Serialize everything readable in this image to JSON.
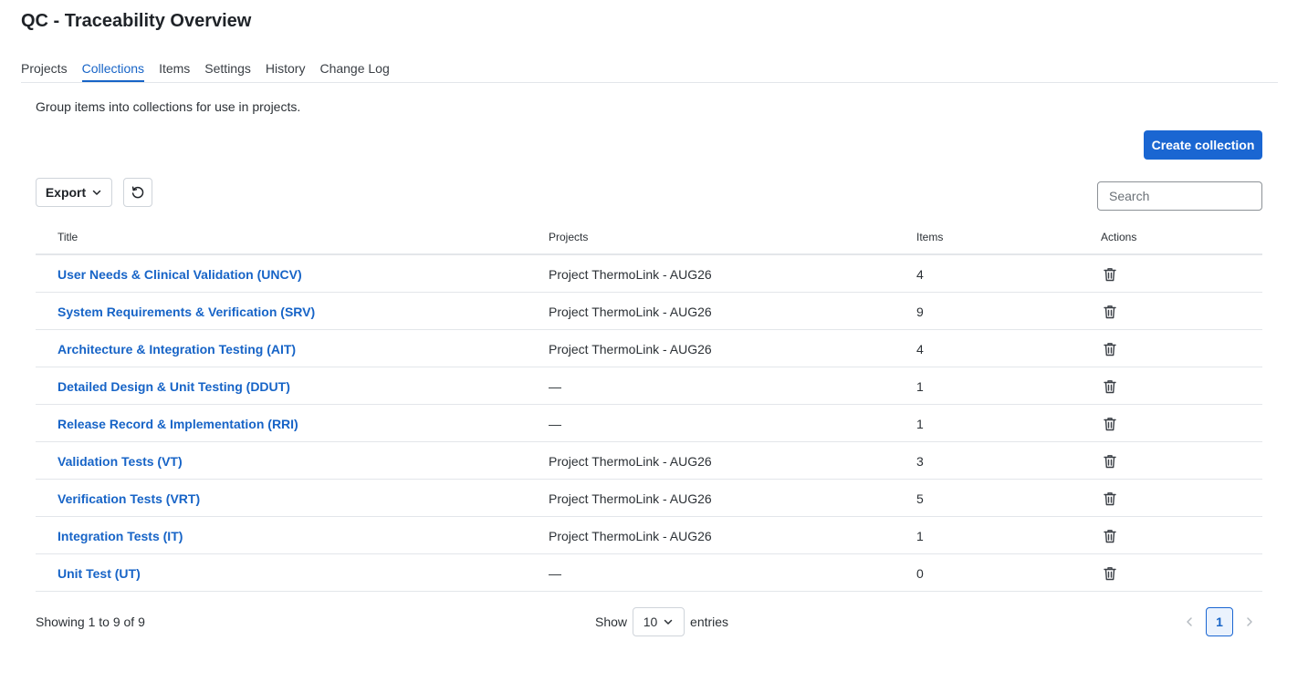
{
  "page": {
    "title": "QC - Traceability Overview"
  },
  "tabs": [
    {
      "label": "Projects"
    },
    {
      "label": "Collections",
      "active": true
    },
    {
      "label": "Items"
    },
    {
      "label": "Settings"
    },
    {
      "label": "History"
    },
    {
      "label": "Change Log"
    }
  ],
  "description": "Group items into collections for use in projects.",
  "toolbar": {
    "create_label": "Create collection",
    "export_label": "Export",
    "search_placeholder": "Search"
  },
  "table": {
    "headers": {
      "title": "Title",
      "projects": "Projects",
      "items": "Items",
      "actions": "Actions"
    },
    "rows": [
      {
        "title": "User Needs & Clinical Validation (UNCV)",
        "project": "Project ThermoLink - AUG26",
        "items": "4"
      },
      {
        "title": "System Requirements & Verification (SRV)",
        "project": "Project ThermoLink - AUG26",
        "items": "9"
      },
      {
        "title": "Architecture & Integration Testing (AIT)",
        "project": "Project ThermoLink - AUG26",
        "items": "4"
      },
      {
        "title": "Detailed Design & Unit Testing (DDUT)",
        "project": "—",
        "items": "1"
      },
      {
        "title": "Release Record & Implementation (RRI)",
        "project": "—",
        "items": "1"
      },
      {
        "title": "Validation Tests (VT)",
        "project": "Project ThermoLink - AUG26",
        "items": "3"
      },
      {
        "title": "Verification Tests (VRT)",
        "project": "Project ThermoLink - AUG26",
        "items": "5"
      },
      {
        "title": "Integration Tests (IT)",
        "project": "Project ThermoLink - AUG26",
        "items": "1"
      },
      {
        "title": "Unit Test (UT)",
        "project": "—",
        "items": "0"
      }
    ]
  },
  "footer": {
    "showing": "Showing 1 to 9 of 9",
    "show_label": "Show",
    "page_size": "10",
    "entries_label": "entries",
    "current_page": "1"
  },
  "colors": {
    "accent": "#1a66d2",
    "link": "#1764c7"
  }
}
